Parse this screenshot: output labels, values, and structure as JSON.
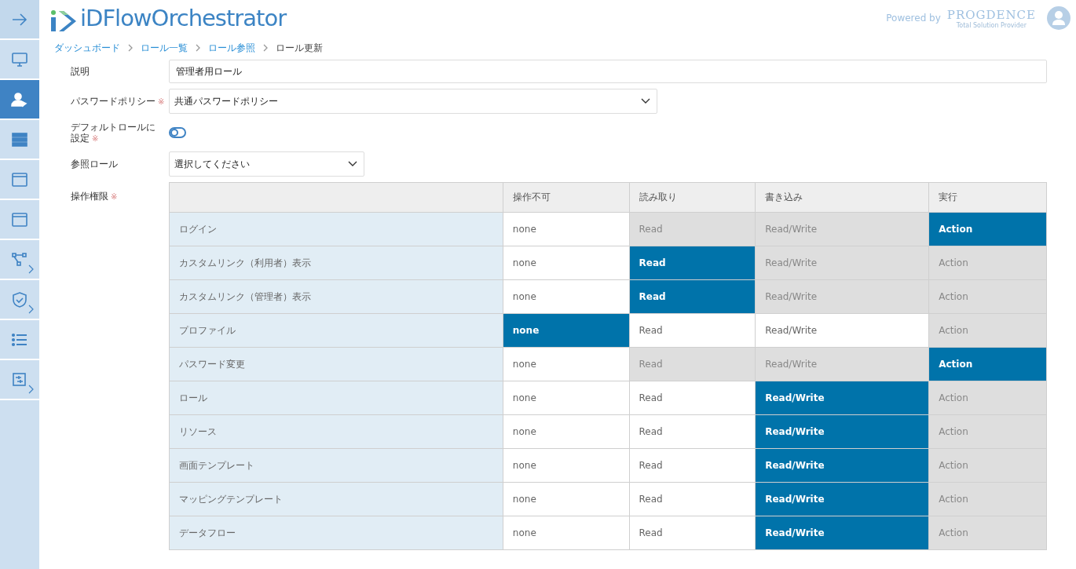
{
  "sidebar": {
    "items": [
      {
        "selected": false,
        "expandable": false
      },
      {
        "selected": false,
        "expandable": false
      },
      {
        "selected": true,
        "expandable": false
      },
      {
        "selected": false,
        "expandable": false
      },
      {
        "selected": false,
        "expandable": false
      },
      {
        "selected": false,
        "expandable": false
      },
      {
        "selected": false,
        "expandable": true
      },
      {
        "selected": false,
        "expandable": true
      },
      {
        "selected": false,
        "expandable": false
      },
      {
        "selected": false,
        "expandable": true
      }
    ]
  },
  "header": {
    "logo": "iDFlowOrchestrator",
    "powered_by": "Powered by",
    "brand": "PROGDENCE",
    "brand_tagline": "Total Solution Provider"
  },
  "breadcrumb": [
    {
      "label": "ダッシュボード",
      "kind": "link"
    },
    {
      "label": "ロール一覧",
      "kind": "link"
    },
    {
      "label": "ロール参照",
      "kind": "link"
    },
    {
      "label": "ロール更新",
      "kind": "current"
    }
  ],
  "form": {
    "description": {
      "label": "説明",
      "value": "管理者用ロール"
    },
    "password_policy": {
      "label": "パスワードポリシー",
      "required_mark": "※",
      "value": "共通パスワードポリシー"
    },
    "default_role": {
      "label": "デフォルトロールに設定",
      "required_mark": "※",
      "on": false
    },
    "reference_role": {
      "label": "参照ロール",
      "placeholder": "選択してください"
    },
    "permissions": {
      "label": "操作権限",
      "required_mark": "※"
    }
  },
  "table": {
    "columns": [
      "操作不可",
      "読み取り",
      "書き込み",
      "実行"
    ],
    "rows": [
      {
        "label": "ログイン",
        "cells": [
          {
            "text": "none",
            "selected": false,
            "disabled": false
          },
          {
            "text": "Read",
            "selected": false,
            "disabled": true
          },
          {
            "text": "Read/Write",
            "selected": false,
            "disabled": true
          },
          {
            "text": "Action",
            "selected": true
          }
        ]
      },
      {
        "label": "カスタムリンク（利用者）表示",
        "cells": [
          {
            "text": "none",
            "selected": false,
            "disabled": false
          },
          {
            "text": "Read",
            "selected": true
          },
          {
            "text": "Read/Write",
            "selected": false,
            "disabled": true
          },
          {
            "text": "Action",
            "selected": false,
            "disabled": true
          }
        ]
      },
      {
        "label": "カスタムリンク（管理者）表示",
        "cells": [
          {
            "text": "none",
            "selected": false,
            "disabled": false
          },
          {
            "text": "Read",
            "selected": true
          },
          {
            "text": "Read/Write",
            "selected": false,
            "disabled": true
          },
          {
            "text": "Action",
            "selected": false,
            "disabled": true
          }
        ]
      },
      {
        "label": "プロファイル",
        "cells": [
          {
            "text": "none",
            "selected": true
          },
          {
            "text": "Read",
            "selected": false,
            "disabled": false
          },
          {
            "text": "Read/Write",
            "selected": false,
            "disabled": false
          },
          {
            "text": "Action",
            "selected": false,
            "disabled": true
          }
        ]
      },
      {
        "label": "パスワード変更",
        "cells": [
          {
            "text": "none",
            "selected": false,
            "disabled": false
          },
          {
            "text": "Read",
            "selected": false,
            "disabled": true
          },
          {
            "text": "Read/Write",
            "selected": false,
            "disabled": true
          },
          {
            "text": "Action",
            "selected": true
          }
        ]
      },
      {
        "label": "ロール",
        "cells": [
          {
            "text": "none",
            "selected": false,
            "disabled": false
          },
          {
            "text": "Read",
            "selected": false,
            "disabled": false
          },
          {
            "text": "Read/Write",
            "selected": true
          },
          {
            "text": "Action",
            "selected": false,
            "disabled": true
          }
        ]
      },
      {
        "label": "リソース",
        "cells": [
          {
            "text": "none",
            "selected": false,
            "disabled": false
          },
          {
            "text": "Read",
            "selected": false,
            "disabled": false
          },
          {
            "text": "Read/Write",
            "selected": true
          },
          {
            "text": "Action",
            "selected": false,
            "disabled": true
          }
        ]
      },
      {
        "label": "画面テンプレート",
        "cells": [
          {
            "text": "none",
            "selected": false,
            "disabled": false
          },
          {
            "text": "Read",
            "selected": false,
            "disabled": false
          },
          {
            "text": "Read/Write",
            "selected": true
          },
          {
            "text": "Action",
            "selected": false,
            "disabled": true
          }
        ]
      },
      {
        "label": "マッピングテンプレート",
        "cells": [
          {
            "text": "none",
            "selected": false,
            "disabled": false
          },
          {
            "text": "Read",
            "selected": false,
            "disabled": false
          },
          {
            "text": "Read/Write",
            "selected": true
          },
          {
            "text": "Action",
            "selected": false,
            "disabled": true
          }
        ]
      },
      {
        "label": "データフロー",
        "cells": [
          {
            "text": "none",
            "selected": false,
            "disabled": false
          },
          {
            "text": "Read",
            "selected": false,
            "disabled": false
          },
          {
            "text": "Read/Write",
            "selected": true
          },
          {
            "text": "Action",
            "selected": false,
            "disabled": true
          }
        ]
      }
    ]
  }
}
